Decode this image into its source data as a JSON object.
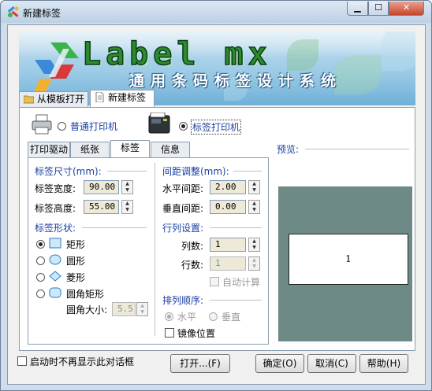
{
  "window": {
    "title": "新建标签"
  },
  "banner": {
    "logo": "Label mx",
    "subtitle": "通用条码标签设计系统"
  },
  "top_tabs": [
    {
      "label": "从模板打开"
    },
    {
      "label": "新建标签"
    }
  ],
  "printer": {
    "normal_label": "普通打印机",
    "label_printer_label": "标签打印机",
    "selected": "label"
  },
  "inner_tabs": [
    {
      "label": "打印驱动"
    },
    {
      "label": "纸张"
    },
    {
      "label": "标签"
    },
    {
      "label": "信息"
    }
  ],
  "label_size": {
    "section": "标签尺寸(mm):",
    "width_label": "标签宽度:",
    "width_value": "90.00",
    "height_label": "标签高度:",
    "height_value": "55.00"
  },
  "label_shape": {
    "section": "标签形状:",
    "options": [
      {
        "label": "矩形",
        "selected": true
      },
      {
        "label": "圆形",
        "selected": false
      },
      {
        "label": "菱形",
        "selected": false
      },
      {
        "label": "圆角矩形",
        "selected": false
      }
    ],
    "corner_label": "圆角大小:",
    "corner_value": "5.5"
  },
  "spacing": {
    "section": "间距调整(mm):",
    "h_label": "水平间距:",
    "h_value": "2.00",
    "v_label": "垂直间距:",
    "v_value": "0.00"
  },
  "layout": {
    "section": "行列设置:",
    "cols_label": "列数:",
    "cols_value": "1",
    "rows_label": "行数:",
    "rows_value": "1",
    "auto_label": "自动计算"
  },
  "order": {
    "section": "排列顺序:",
    "horizontal": "水平",
    "vertical": "垂直",
    "mirror": "镜像位置"
  },
  "preview": {
    "title": "预览:",
    "label_text": "1"
  },
  "footer": {
    "no_show": "启动时不再显示此对话框",
    "open_btn": "打开...(F)",
    "ok_btn": "确定(O)",
    "cancel_btn": "取消(C)",
    "help_btn": "帮助(H)"
  },
  "colors": {
    "accent": "#1a3fa0",
    "preview_bg": "#6e8a86",
    "spin_bg": "#efe9d8"
  }
}
